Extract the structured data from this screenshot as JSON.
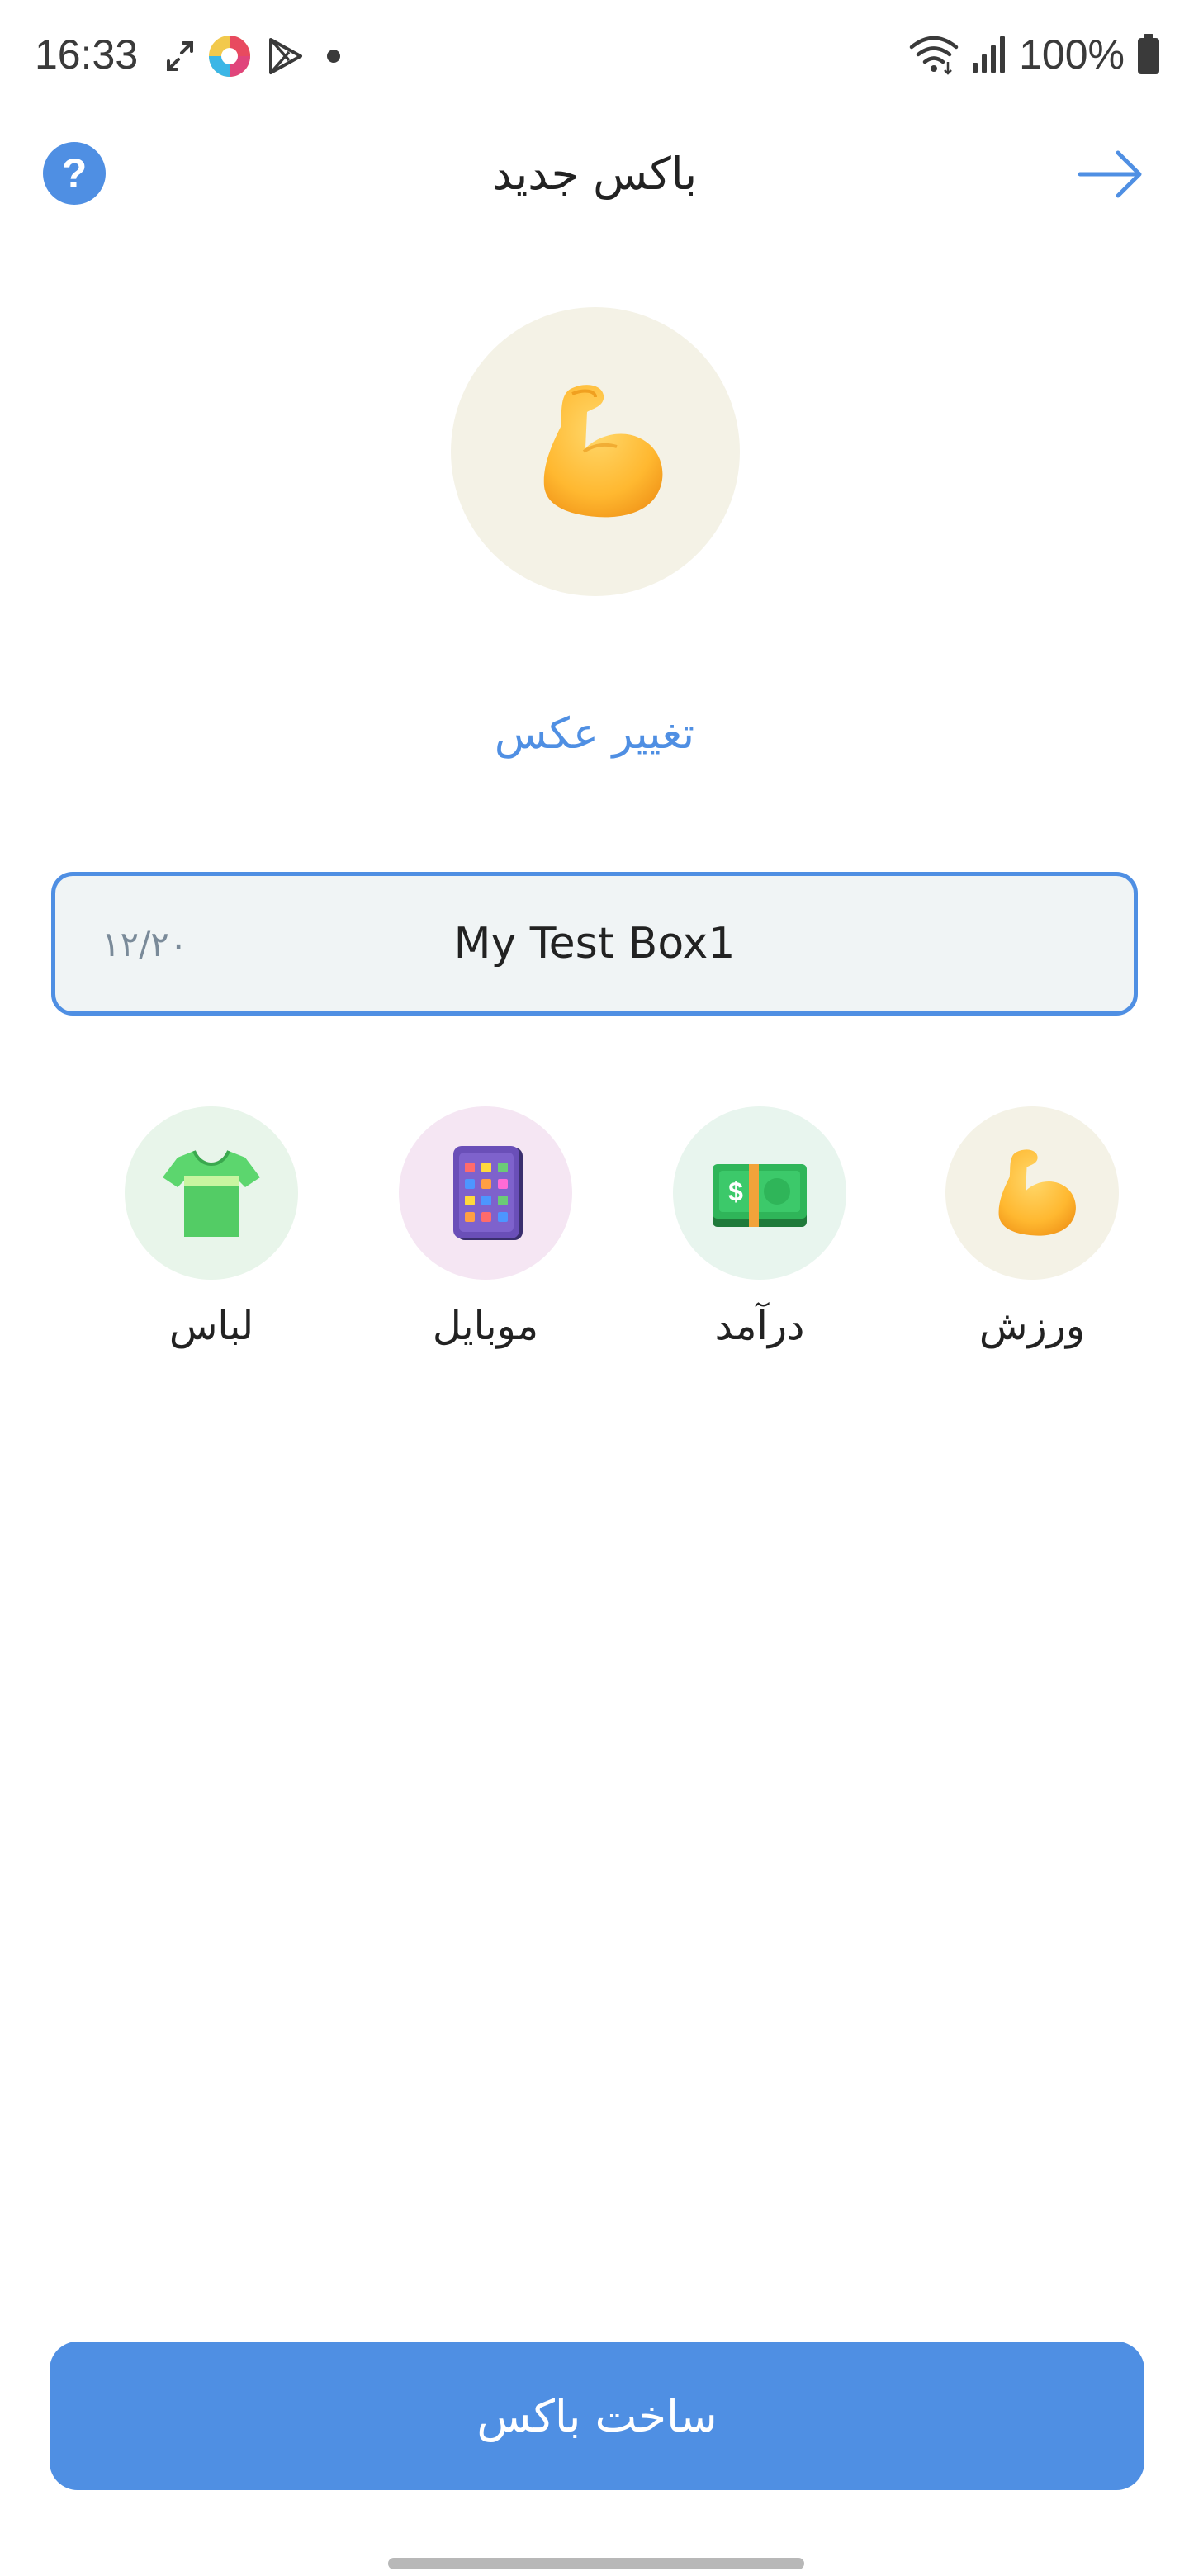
{
  "status_bar": {
    "time": "16:33",
    "battery": "100%"
  },
  "header": {
    "title": "باکس جدید",
    "help_label": "?"
  },
  "photo": {
    "change_label": "تغییر عکس"
  },
  "box_name": {
    "value": "My Test Box1",
    "counter": "۱۲/۲۰"
  },
  "categories": [
    {
      "label": "ورزش",
      "icon": "flexed-biceps-icon",
      "color": "#f4f2e6"
    },
    {
      "label": "درآمد",
      "icon": "money-bill-icon",
      "color": "#e8f5ee"
    },
    {
      "label": "موبایل",
      "icon": "mobile-phone-icon",
      "color": "#f5e6f3"
    },
    {
      "label": "لباس",
      "icon": "t-shirt-icon",
      "color": "#e8f5ea"
    }
  ],
  "actions": {
    "create_label": "ساخت باکس"
  },
  "colors": {
    "accent": "#4f8fe3"
  }
}
